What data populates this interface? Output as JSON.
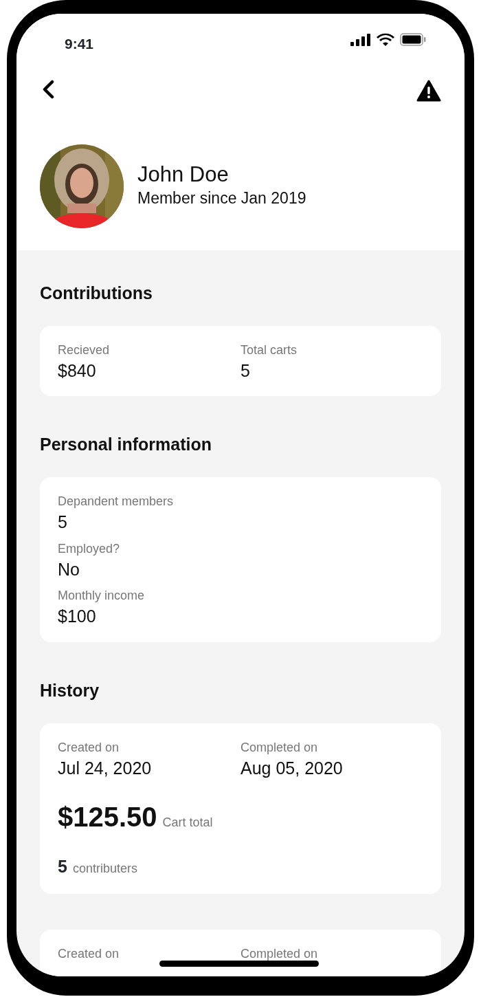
{
  "status_bar": {
    "time": "9:41"
  },
  "profile": {
    "name": "John Doe",
    "subtitle": "Member since Jan 2019"
  },
  "contributions": {
    "title": "Contributions",
    "fields": [
      {
        "label": "Recieved",
        "value": "$840"
      },
      {
        "label": "Total carts",
        "value": "5"
      }
    ]
  },
  "personal_information": {
    "title": "Personal information",
    "fields": [
      {
        "label": "Depandent members",
        "value": "5"
      },
      {
        "label": "Employed?",
        "value": "No"
      },
      {
        "label": "Monthly income",
        "value": "$100"
      }
    ]
  },
  "history": {
    "title": "History",
    "entries": [
      {
        "created_label": "Created on",
        "created": "Jul 24, 2020",
        "completed_label": "Completed on",
        "completed": "Aug 05, 2020",
        "amount": "$125.50",
        "amount_label": "Cart total",
        "contributors_count": "5",
        "contributors_label": "contributers"
      },
      {
        "created_label": "Created on",
        "completed_label": "Completed on"
      }
    ]
  }
}
